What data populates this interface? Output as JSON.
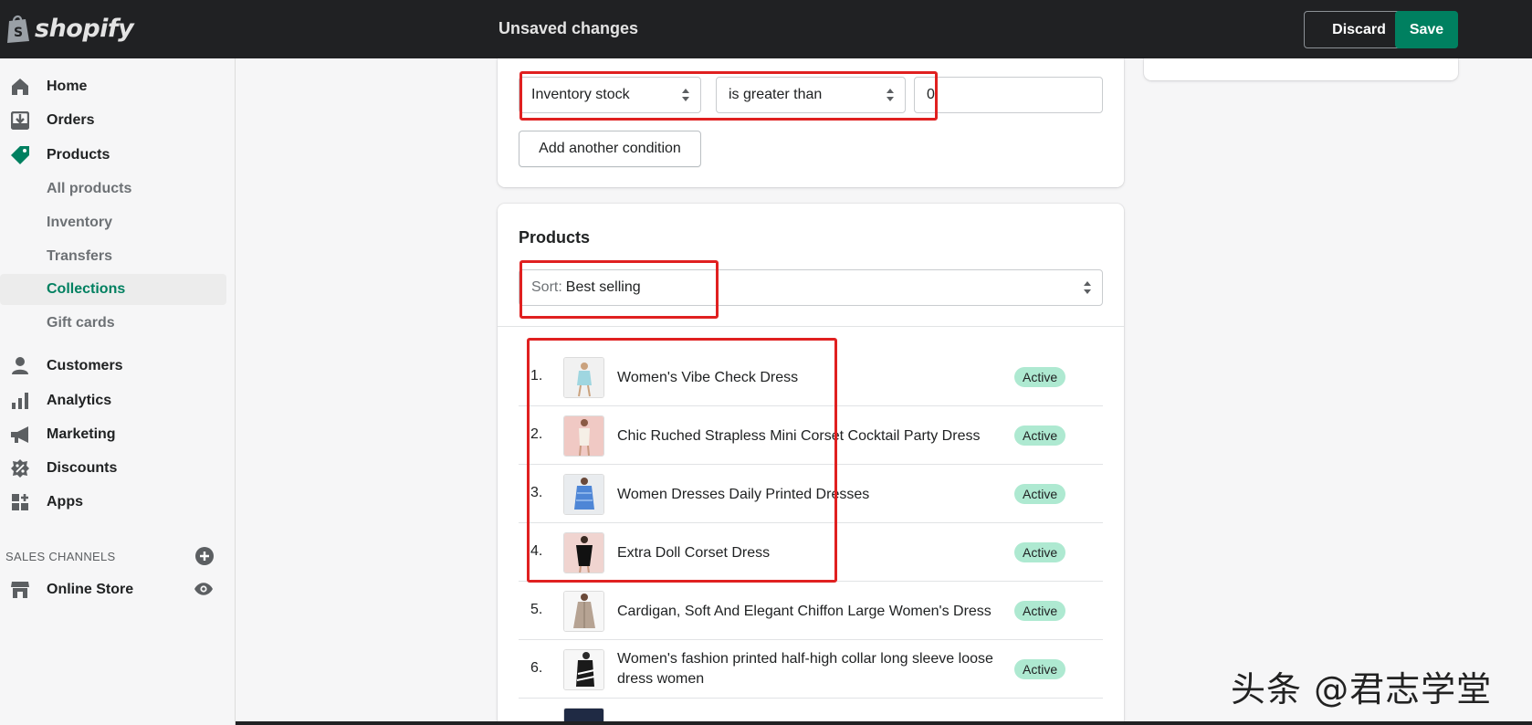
{
  "topbar": {
    "logo_text": "shopify",
    "title": "Unsaved changes",
    "discard_label": "Discard",
    "save_label": "Save"
  },
  "sidebar": {
    "items": [
      {
        "label": "Home",
        "icon": "home-icon"
      },
      {
        "label": "Orders",
        "icon": "orders-icon"
      },
      {
        "label": "Products",
        "icon": "tag-icon"
      },
      {
        "label": "All products"
      },
      {
        "label": "Inventory"
      },
      {
        "label": "Transfers"
      },
      {
        "label": "Collections"
      },
      {
        "label": "Gift cards"
      },
      {
        "label": "Customers",
        "icon": "person-icon"
      },
      {
        "label": "Analytics",
        "icon": "bar-chart-icon"
      },
      {
        "label": "Marketing",
        "icon": "megaphone-icon"
      },
      {
        "label": "Discounts",
        "icon": "discount-icon"
      },
      {
        "label": "Apps",
        "icon": "apps-icon"
      }
    ],
    "sales_channels_heading": "SALES CHANNELS",
    "online_store_label": "Online Store"
  },
  "conditions": {
    "field": "Inventory stock",
    "operator": "is greater than",
    "value": "0",
    "add_condition_label": "Add another condition"
  },
  "products_card": {
    "title": "Products",
    "sort_prefix": "Sort:",
    "sort_value": "Best selling",
    "rows": [
      {
        "num": "1.",
        "name": "Women's Vibe Check Dress",
        "status": "Active"
      },
      {
        "num": "2.",
        "name": "Chic Ruched Strapless Mini Corset Cocktail Party Dress",
        "status": "Active"
      },
      {
        "num": "3.",
        "name": "Women Dresses Daily Printed Dresses",
        "status": "Active"
      },
      {
        "num": "4.",
        "name": "Extra Doll Corset Dress",
        "status": "Active"
      },
      {
        "num": "5.",
        "name": "Cardigan, Soft And Elegant Chiffon Large Women's Dress",
        "status": "Active"
      },
      {
        "num": "6.",
        "name": "Women's fashion printed half-high collar long sleeve loose dress women",
        "status": "Active"
      }
    ]
  },
  "watermark": "头条 @君志学堂",
  "colors": {
    "topbar_bg": "#202123",
    "save_green": "#008060",
    "active_badge": "#aee9d1",
    "annotation_red": "#e02020"
  }
}
